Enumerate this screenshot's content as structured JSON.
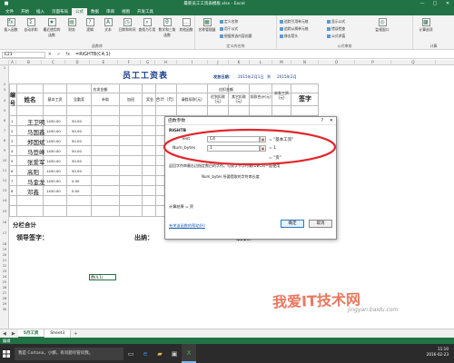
{
  "window": {
    "title": "最新员工工资表模板.xlsx - Excel",
    "min": "—",
    "max": "□",
    "close": "✕"
  },
  "ribbon_tabs": [
    "文件",
    "开始",
    "插入",
    "页面布局",
    "公式",
    "数据",
    "审阅",
    "视图",
    "开发工具"
  ],
  "active_tab": "公式",
  "ribbon": {
    "insert_fn": "插入函数",
    "autosum": "自动求和",
    "recent": "最近使用的函数",
    "financial": "财务",
    "logical": "逻辑",
    "text": "文本",
    "datetime": "日期和时间",
    "lookup": "查找与引用",
    "math": "数学和三角函数",
    "more": "其他函数",
    "group_lib": "函数库",
    "name_mgr": "名称管理器",
    "define_name": "定义名称",
    "use_formula": "用于公式",
    "from_sel": "根据所选内容创建",
    "group_names": "定义的名称",
    "trace_prec": "追踪引用单元格",
    "trace_dep": "追踪从属单元格",
    "remove_arrows": "移去箭头",
    "show_formulas": "显示公式",
    "error_check": "错误检查",
    "eval_formula": "公式求值",
    "watch": "监视窗口",
    "group_audit": "公式审核",
    "calc_options": "计算选项",
    "group_calc": "计算"
  },
  "formula_bar": {
    "name_box": "E23",
    "cancel": "✕",
    "enter": "✓",
    "fx": "fx",
    "formula": "=RIGHTB(C4,1)"
  },
  "columns": [
    "A",
    "B",
    "C",
    "D",
    "E",
    "F",
    "G",
    "H",
    "I",
    "J",
    "K",
    "L",
    "M",
    "N",
    "O",
    "P",
    "Q"
  ],
  "rows": [
    "1",
    "2",
    "3",
    "4",
    "5",
    "6",
    "7",
    "8",
    "9",
    "10",
    "11",
    "12",
    "13",
    "14",
    "15",
    "16",
    "17",
    "18",
    "19",
    "20",
    "21",
    "22",
    "23",
    "24",
    "25",
    "26",
    "27",
    "28",
    "29",
    "30"
  ],
  "sheet": {
    "title": "员工工资表",
    "dept_label": "发放日期：",
    "date1": "2015年2月1日",
    "date_to": "到",
    "date2": "2015年2月",
    "col_num": "编号",
    "col_name": "姓名",
    "grp_should": "应发金额",
    "grp_deduct": "应扣金额",
    "h_base": "基本工资",
    "h_allow": "全勤奖",
    "h_subsidy": "补助",
    "h_overtime": "加班",
    "h_bonus": "奖金",
    "h_total": "合计（元）",
    "h_late": "请假扣款(元)",
    "h_social": "迟到扣款(元)",
    "h_fund": "其它扣款(元)",
    "h_ded_total": "扣款合计(元)",
    "h_actual": "实发工资(元)",
    "h_sign": "签字",
    "employees": [
      {
        "no": "1",
        "name": "王卫明",
        "base": "1450.00",
        "v2": "50.00"
      },
      {
        "no": "2",
        "name": "马国鑫",
        "base": "1450.00",
        "v2": "50.00"
      },
      {
        "no": "3",
        "name": "郑国斌",
        "base": "1450.00",
        "v2": "50.00"
      },
      {
        "no": "4",
        "name": "马登峰",
        "base": "1450.00",
        "v2": "50.00"
      },
      {
        "no": "5",
        "name": "张爱军",
        "base": "1450.00",
        "v2": "50.00"
      },
      {
        "no": "6",
        "name": "高阳",
        "base": "1450.00",
        "v2": "50.00"
      },
      {
        "no": "7",
        "name": "马金龙",
        "base": "1450.00",
        "v2": "0.00"
      },
      {
        "no": "8",
        "name": "邓鑫",
        "base": "1450.00",
        "v2": "0.00"
      }
    ],
    "subtotal": "分栏合计",
    "footer_leader": "领导签字：",
    "footer_cashier": "出纳：",
    "footer_maker": "制表：",
    "cell_e23": "费(4,1)"
  },
  "dialog": {
    "title": "函数参数",
    "help": "?",
    "close": "✕",
    "fn_name": "RIGHTB",
    "arg1_label": "Text",
    "arg1_value": "C4",
    "arg1_result": "= \"基本工资\"",
    "arg2_label": "Num_bytes",
    "arg2_value": "1",
    "arg2_result": "= 1",
    "fn_result": "= \"资\"",
    "desc": "返回字符串最右边指定数目的字符。与双字节字符集(DBCS)一起使用",
    "arg_desc": "Num_bytes  所要提取的字符串长度",
    "calc_result": "计算结果 = 资",
    "help_link": "有关该函数的帮助(H)",
    "ok": "确定",
    "cancel": "取消"
  },
  "sheet_tabs": [
    "5月工资",
    "Sheet3"
  ],
  "sheet_add": "+",
  "status": "编辑",
  "taskbar": {
    "search": "我是 Cortana，小娜。有问题尽管问我。",
    "time": "11:10",
    "date": "2016-02-23"
  },
  "watermark": "我爱IT技术网",
  "watermark_url": "jingyan.baidu.com",
  "colors": {
    "excel_green": "#217346",
    "highlight_red": "#e2262a"
  }
}
